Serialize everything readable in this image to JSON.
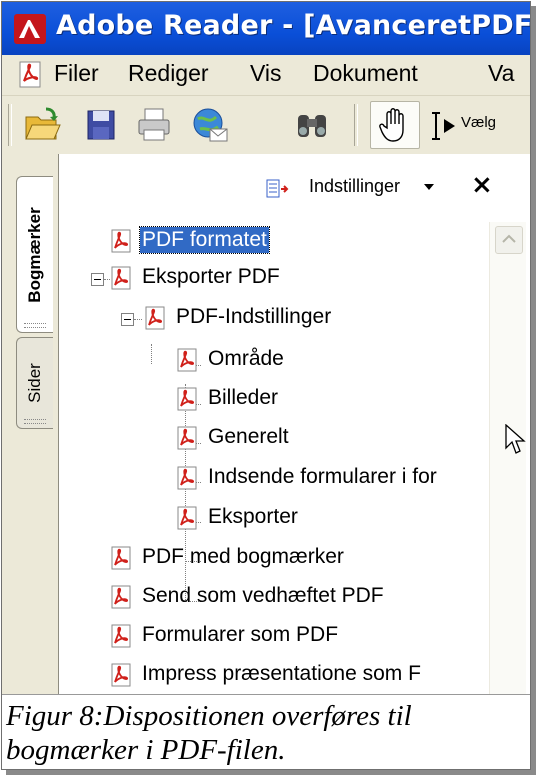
{
  "window": {
    "title": "Adobe Reader - [AvanceretPDF.pd"
  },
  "menu": {
    "items": [
      "Filer",
      "Rediger",
      "Vis",
      "Dokument",
      "Va"
    ]
  },
  "toolbar": {
    "icons": [
      "open-icon",
      "save-icon",
      "print-icon",
      "email-icon",
      "search-icon",
      "hand-tool-icon",
      "select-text-icon"
    ],
    "select_label": "Vælg"
  },
  "side_tabs": {
    "bookmarks": "Bogmærker",
    "pages": "Sider"
  },
  "bookmarks_panel": {
    "options_label": "Indstillinger",
    "close_symbol": "×",
    "tree": [
      {
        "label": "PDF formatet",
        "level": 0,
        "selected": true
      },
      {
        "label": "Eksporter PDF",
        "level": 0,
        "expanded": true
      },
      {
        "label": "PDF-Indstillinger",
        "level": 1,
        "expanded": true
      },
      {
        "label": "Område",
        "level": 2
      },
      {
        "label": "Billeder",
        "level": 2
      },
      {
        "label": "Generelt",
        "level": 2
      },
      {
        "label": "Indsende formularer i for",
        "level": 2
      },
      {
        "label": "Eksporter",
        "level": 2
      },
      {
        "label": "PDF med bogmærker",
        "level": 0
      },
      {
        "label": "Send som vedhæftet PDF",
        "level": 0
      },
      {
        "label": "Formularer som PDF",
        "level": 0
      },
      {
        "label": "Impress præsentatione som F",
        "level": 0
      }
    ]
  },
  "caption": {
    "text": "Figur 8:Dispositionen overføres til bogmærker i PDF-filen."
  },
  "colors": {
    "titlebar": "#0a4fd8",
    "selection": "#316ac5",
    "pdf_red": "#d0201a"
  }
}
